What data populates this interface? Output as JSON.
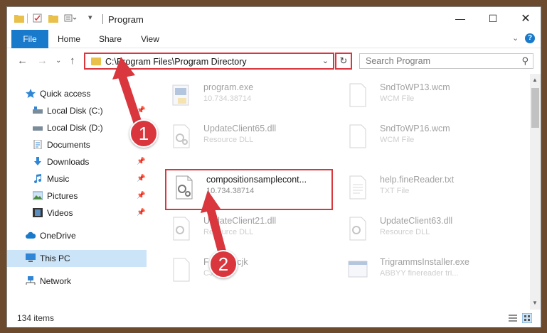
{
  "window": {
    "title": "Program"
  },
  "ribbon": {
    "tabs": [
      "File",
      "Home",
      "Share",
      "View"
    ]
  },
  "address": {
    "path": "C:\\Program Files\\Program Directory"
  },
  "search": {
    "placeholder": "Search Program"
  },
  "nav": {
    "items": [
      {
        "label": "Quick access",
        "icon": "star-icon"
      },
      {
        "label": "Local Disk (C:)",
        "icon": "drive-icon"
      },
      {
        "label": "Local Disk (D:)",
        "icon": "drive-icon"
      },
      {
        "label": "Documents",
        "icon": "documents-icon"
      },
      {
        "label": "Downloads",
        "icon": "download-icon"
      },
      {
        "label": "Music",
        "icon": "music-icon"
      },
      {
        "label": "Pictures",
        "icon": "pictures-icon"
      },
      {
        "label": "Videos",
        "icon": "videos-icon"
      },
      {
        "label": "OneDrive",
        "icon": "cloud-icon"
      },
      {
        "label": "This PC",
        "icon": "computer-icon"
      },
      {
        "label": "Network",
        "icon": "network-icon"
      }
    ]
  },
  "files": [
    {
      "name": "program.exe",
      "sub": "10.734.38714"
    },
    {
      "name": "SndToWP13.wcm",
      "sub": "WCM File"
    },
    {
      "name": "UpdateClient65.dll",
      "sub": "Resource DLL"
    },
    {
      "name": "SndToWP16.wcm",
      "sub": "WCM File"
    },
    {
      "name": "compositionsamplecont...",
      "sub": "10.734.38714"
    },
    {
      "name": "help.fineReader.txt",
      "sub": "TXT File"
    },
    {
      "name": "UpdateClient21.dll",
      "sub": "Resource DLL"
    },
    {
      "name": "UpdateClient63.dll",
      "sub": "Resource DLL"
    },
    {
      "name": "FarEast.cjk",
      "sub": "CJK File"
    },
    {
      "name": "TrigrammsInstaller.exe",
      "sub": "ABBYY finereader tri..."
    }
  ],
  "status": {
    "count": "134 items"
  },
  "callouts": [
    "1",
    "2"
  ],
  "colors": {
    "accent": "#1979ca",
    "callout": "#d9363e",
    "selected": "#cce4f7"
  }
}
